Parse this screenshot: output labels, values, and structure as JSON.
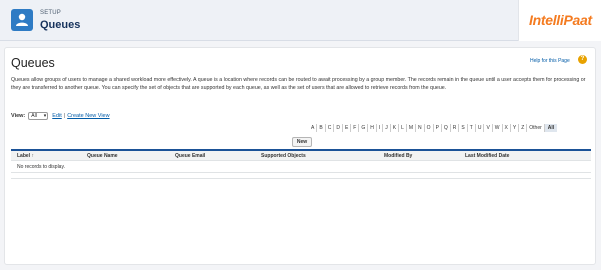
{
  "header": {
    "section_label": "SETUP",
    "title": "Queues",
    "icon": "setup-queue-icon",
    "brand_logo_text": "IntelliPaat"
  },
  "page": {
    "title": "Queues",
    "help_link": "Help for this Page",
    "description": "Queues allow groups of users to manage a shared workload more effectively. A queue is a location where records can be routed to await processing by a group member. The records remain in the queue until a user accepts them for processing or they are transferred to another queue. You can specify the set of objects that are supported by each queue, as well as the set of users that are allowed to retrieve records from the queue."
  },
  "view": {
    "label": "View:",
    "selected": "All",
    "edit_link": "Edit",
    "separator": "|",
    "create_link": "Create New View"
  },
  "alphabet": [
    "A",
    "B",
    "C",
    "D",
    "E",
    "F",
    "G",
    "H",
    "I",
    "J",
    "K",
    "L",
    "M",
    "N",
    "O",
    "P",
    "Q",
    "R",
    "S",
    "T",
    "U",
    "V",
    "W",
    "X",
    "Y",
    "Z",
    "Other",
    "All"
  ],
  "alphabet_active": "All",
  "actions": {
    "new_button": "New"
  },
  "table": {
    "columns": [
      "Label",
      "Queue Name",
      "Queue Email",
      "Supported Objects",
      "Modified By",
      "Last Modified Date"
    ],
    "sort_indicator": "↑",
    "empty_message": "No records to display."
  },
  "colors": {
    "accent": "#1b5297",
    "link": "#015ba7",
    "brand": "#f47b20",
    "setup_icon": "#2e7bc4"
  }
}
